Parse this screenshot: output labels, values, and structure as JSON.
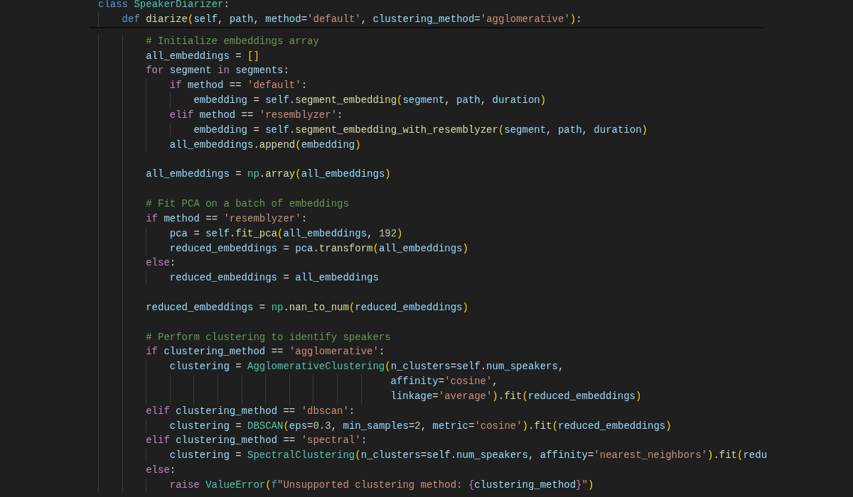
{
  "sticky_header": [
    {
      "kind": "code",
      "tokens": [
        {
          "kind": "kw",
          "text": "class "
        },
        {
          "kind": "cls",
          "text": "SpeakerDiarizer"
        },
        {
          "kind": "op",
          "text": ":"
        }
      ],
      "children": [
        {
          "kind": "code",
          "tokens": [
            {
              "kind": "kw",
              "text": "def "
            },
            {
              "kind": "fn",
              "text": "diarize"
            },
            {
              "kind": "br1",
              "text": "("
            },
            {
              "kind": "var",
              "text": "self"
            },
            {
              "kind": "op",
              "text": ", "
            },
            {
              "kind": "var",
              "text": "path"
            },
            {
              "kind": "op",
              "text": ", "
            },
            {
              "kind": "var",
              "text": "method"
            },
            {
              "kind": "op",
              "text": "="
            },
            {
              "kind": "str",
              "text": "'default'"
            },
            {
              "kind": "op",
              "text": ", "
            },
            {
              "kind": "var",
              "text": "clustering_method"
            },
            {
              "kind": "op",
              "text": "="
            },
            {
              "kind": "str",
              "text": "'agglomerative'"
            },
            {
              "kind": "br1",
              "text": ")"
            },
            {
              "kind": "op",
              "text": ":"
            }
          ]
        }
      ]
    }
  ],
  "code_lines": [
    {
      "kind": "code",
      "tokens": [
        {
          "kind": "cmt",
          "text": "# Initialize embeddings array"
        }
      ]
    },
    {
      "kind": "code",
      "tokens": [
        {
          "kind": "var",
          "text": "all_embeddings"
        },
        {
          "kind": "op",
          "text": " = "
        },
        {
          "kind": "br1",
          "text": "[]"
        }
      ]
    },
    {
      "kind": "code",
      "tokens": [
        {
          "kind": "ctrl",
          "text": "for "
        },
        {
          "kind": "var",
          "text": "segment"
        },
        {
          "kind": "ctrl",
          "text": " in "
        },
        {
          "kind": "var",
          "text": "segments"
        },
        {
          "kind": "op",
          "text": ":"
        }
      ],
      "children": [
        {
          "kind": "code",
          "tokens": [
            {
              "kind": "ctrl",
              "text": "if "
            },
            {
              "kind": "var",
              "text": "method"
            },
            {
              "kind": "op",
              "text": " == "
            },
            {
              "kind": "str",
              "text": "'default'"
            },
            {
              "kind": "op",
              "text": ":"
            }
          ],
          "children": [
            {
              "kind": "code",
              "tokens": [
                {
                  "kind": "var",
                  "text": "embedding"
                },
                {
                  "kind": "op",
                  "text": " = "
                },
                {
                  "kind": "var",
                  "text": "self"
                },
                {
                  "kind": "op",
                  "text": "."
                },
                {
                  "kind": "fn",
                  "text": "segment_embedding"
                },
                {
                  "kind": "br1",
                  "text": "("
                },
                {
                  "kind": "var",
                  "text": "segment"
                },
                {
                  "kind": "op",
                  "text": ", "
                },
                {
                  "kind": "var",
                  "text": "path"
                },
                {
                  "kind": "op",
                  "text": ", "
                },
                {
                  "kind": "var",
                  "text": "duration"
                },
                {
                  "kind": "br1",
                  "text": ")"
                }
              ]
            }
          ]
        },
        {
          "kind": "code",
          "tokens": [
            {
              "kind": "ctrl",
              "text": "elif "
            },
            {
              "kind": "var",
              "text": "method"
            },
            {
              "kind": "op",
              "text": " == "
            },
            {
              "kind": "str",
              "text": "'resemblyzer'"
            },
            {
              "kind": "op",
              "text": ":"
            }
          ],
          "children": [
            {
              "kind": "code",
              "tokens": [
                {
                  "kind": "var",
                  "text": "embedding"
                },
                {
                  "kind": "op",
                  "text": " = "
                },
                {
                  "kind": "var",
                  "text": "self"
                },
                {
                  "kind": "op",
                  "text": "."
                },
                {
                  "kind": "fn",
                  "text": "segment_embedding_with_resemblyzer"
                },
                {
                  "kind": "br1",
                  "text": "("
                },
                {
                  "kind": "var",
                  "text": "segment"
                },
                {
                  "kind": "op",
                  "text": ", "
                },
                {
                  "kind": "var",
                  "text": "path"
                },
                {
                  "kind": "op",
                  "text": ", "
                },
                {
                  "kind": "var",
                  "text": "duration"
                },
                {
                  "kind": "br1",
                  "text": ")"
                }
              ]
            }
          ]
        },
        {
          "kind": "code",
          "tokens": [
            {
              "kind": "var",
              "text": "all_embeddings"
            },
            {
              "kind": "op",
              "text": "."
            },
            {
              "kind": "fn",
              "text": "append"
            },
            {
              "kind": "br1",
              "text": "("
            },
            {
              "kind": "var",
              "text": "embedding"
            },
            {
              "kind": "br1",
              "text": ")"
            }
          ]
        }
      ]
    },
    {
      "kind": "blank"
    },
    {
      "kind": "code",
      "tokens": [
        {
          "kind": "var",
          "text": "all_embeddings"
        },
        {
          "kind": "op",
          "text": " = "
        },
        {
          "kind": "cls",
          "text": "np"
        },
        {
          "kind": "op",
          "text": "."
        },
        {
          "kind": "fn",
          "text": "array"
        },
        {
          "kind": "br1",
          "text": "("
        },
        {
          "kind": "var",
          "text": "all_embeddings"
        },
        {
          "kind": "br1",
          "text": ")"
        }
      ]
    },
    {
      "kind": "blank"
    },
    {
      "kind": "code",
      "tokens": [
        {
          "kind": "cmt",
          "text": "# Fit PCA on a batch of embeddings"
        }
      ]
    },
    {
      "kind": "code",
      "tokens": [
        {
          "kind": "ctrl",
          "text": "if "
        },
        {
          "kind": "var",
          "text": "method"
        },
        {
          "kind": "op",
          "text": " == "
        },
        {
          "kind": "str",
          "text": "'resemblyzer'"
        },
        {
          "kind": "op",
          "text": ":"
        }
      ],
      "children": [
        {
          "kind": "code",
          "tokens": [
            {
              "kind": "var",
              "text": "pca"
            },
            {
              "kind": "op",
              "text": " = "
            },
            {
              "kind": "var",
              "text": "self"
            },
            {
              "kind": "op",
              "text": "."
            },
            {
              "kind": "fn",
              "text": "fit_pca"
            },
            {
              "kind": "br1",
              "text": "("
            },
            {
              "kind": "var",
              "text": "all_embeddings"
            },
            {
              "kind": "op",
              "text": ", "
            },
            {
              "kind": "num",
              "text": "192"
            },
            {
              "kind": "br1",
              "text": ")"
            }
          ]
        },
        {
          "kind": "code",
          "tokens": [
            {
              "kind": "var",
              "text": "reduced_embeddings"
            },
            {
              "kind": "op",
              "text": " = "
            },
            {
              "kind": "var",
              "text": "pca"
            },
            {
              "kind": "op",
              "text": "."
            },
            {
              "kind": "fn",
              "text": "transform"
            },
            {
              "kind": "br1",
              "text": "("
            },
            {
              "kind": "var",
              "text": "all_embeddings"
            },
            {
              "kind": "br1",
              "text": ")"
            }
          ]
        }
      ]
    },
    {
      "kind": "code",
      "tokens": [
        {
          "kind": "ctrl",
          "text": "else"
        },
        {
          "kind": "op",
          "text": ":"
        }
      ],
      "children": [
        {
          "kind": "code",
          "tokens": [
            {
              "kind": "var",
              "text": "reduced_embeddings"
            },
            {
              "kind": "op",
              "text": " = "
            },
            {
              "kind": "var",
              "text": "all_embeddings"
            }
          ]
        }
      ]
    },
    {
      "kind": "blank"
    },
    {
      "kind": "code",
      "tokens": [
        {
          "kind": "var",
          "text": "reduced_embeddings"
        },
        {
          "kind": "op",
          "text": " = "
        },
        {
          "kind": "cls",
          "text": "np"
        },
        {
          "kind": "op",
          "text": "."
        },
        {
          "kind": "fn",
          "text": "nan_to_num"
        },
        {
          "kind": "br1",
          "text": "("
        },
        {
          "kind": "var",
          "text": "reduced_embeddings"
        },
        {
          "kind": "br1",
          "text": ")"
        }
      ]
    },
    {
      "kind": "blank"
    },
    {
      "kind": "code",
      "tokens": [
        {
          "kind": "cmt",
          "text": "# Perform clustering to identify speakers"
        }
      ]
    },
    {
      "kind": "code",
      "tokens": [
        {
          "kind": "ctrl",
          "text": "if "
        },
        {
          "kind": "var",
          "text": "clustering_method"
        },
        {
          "kind": "op",
          "text": " == "
        },
        {
          "kind": "str",
          "text": "'agglomerative'"
        },
        {
          "kind": "op",
          "text": ":"
        }
      ],
      "children": [
        {
          "kind": "code",
          "tokens": [
            {
              "kind": "var",
              "text": "clustering"
            },
            {
              "kind": "op",
              "text": " = "
            },
            {
              "kind": "cls",
              "text": "AgglomerativeClustering"
            },
            {
              "kind": "br1",
              "text": "("
            },
            {
              "kind": "var",
              "text": "n_clusters"
            },
            {
              "kind": "op",
              "text": "="
            },
            {
              "kind": "var",
              "text": "self"
            },
            {
              "kind": "op",
              "text": "."
            },
            {
              "kind": "var",
              "text": "num_speakers"
            },
            {
              "kind": "op",
              "text": ","
            }
          ],
          "children": [
            {
              "kind": "continuation",
              "tokens": [
                {
                  "kind": "var",
                  "text": "affinity"
                },
                {
                  "kind": "op",
                  "text": "="
                },
                {
                  "kind": "str",
                  "text": "'cosine'"
                },
                {
                  "kind": "op",
                  "text": ","
                }
              ]
            },
            {
              "kind": "continuation",
              "tokens": [
                {
                  "kind": "var",
                  "text": "linkage"
                },
                {
                  "kind": "op",
                  "text": "="
                },
                {
                  "kind": "str",
                  "text": "'average'"
                },
                {
                  "kind": "br1",
                  "text": ")"
                },
                {
                  "kind": "op",
                  "text": "."
                },
                {
                  "kind": "fn",
                  "text": "fit"
                },
                {
                  "kind": "br1",
                  "text": "("
                },
                {
                  "kind": "var",
                  "text": "reduced_embeddings"
                },
                {
                  "kind": "br1",
                  "text": ")"
                }
              ]
            }
          ]
        }
      ]
    },
    {
      "kind": "code",
      "tokens": [
        {
          "kind": "ctrl",
          "text": "elif "
        },
        {
          "kind": "var",
          "text": "clustering_method"
        },
        {
          "kind": "op",
          "text": " == "
        },
        {
          "kind": "str",
          "text": "'dbscan'"
        },
        {
          "kind": "op",
          "text": ":"
        }
      ],
      "children": [
        {
          "kind": "code",
          "tokens": [
            {
              "kind": "var",
              "text": "clustering"
            },
            {
              "kind": "op",
              "text": " = "
            },
            {
              "kind": "cls",
              "text": "DBSCAN"
            },
            {
              "kind": "br1",
              "text": "("
            },
            {
              "kind": "var",
              "text": "eps"
            },
            {
              "kind": "op",
              "text": "="
            },
            {
              "kind": "num",
              "text": "0.3"
            },
            {
              "kind": "op",
              "text": ", "
            },
            {
              "kind": "var",
              "text": "min_samples"
            },
            {
              "kind": "op",
              "text": "="
            },
            {
              "kind": "num",
              "text": "2"
            },
            {
              "kind": "op",
              "text": ", "
            },
            {
              "kind": "var",
              "text": "metric"
            },
            {
              "kind": "op",
              "text": "="
            },
            {
              "kind": "str",
              "text": "'cosine'"
            },
            {
              "kind": "br1",
              "text": ")"
            },
            {
              "kind": "op",
              "text": "."
            },
            {
              "kind": "fn",
              "text": "fit"
            },
            {
              "kind": "br1",
              "text": "("
            },
            {
              "kind": "var",
              "text": "reduced_embeddings"
            },
            {
              "kind": "br1",
              "text": ")"
            }
          ]
        }
      ]
    },
    {
      "kind": "code",
      "tokens": [
        {
          "kind": "ctrl",
          "text": "elif "
        },
        {
          "kind": "var",
          "text": "clustering_method"
        },
        {
          "kind": "op",
          "text": " == "
        },
        {
          "kind": "str",
          "text": "'spectral'"
        },
        {
          "kind": "op",
          "text": ":"
        }
      ],
      "children": [
        {
          "kind": "code",
          "tokens": [
            {
              "kind": "var",
              "text": "clustering"
            },
            {
              "kind": "op",
              "text": " = "
            },
            {
              "kind": "cls",
              "text": "SpectralClustering"
            },
            {
              "kind": "br1",
              "text": "("
            },
            {
              "kind": "var",
              "text": "n_clusters"
            },
            {
              "kind": "op",
              "text": "="
            },
            {
              "kind": "var",
              "text": "self"
            },
            {
              "kind": "op",
              "text": "."
            },
            {
              "kind": "var",
              "text": "num_speakers"
            },
            {
              "kind": "op",
              "text": ", "
            },
            {
              "kind": "var",
              "text": "affinity"
            },
            {
              "kind": "op",
              "text": "="
            },
            {
              "kind": "str",
              "text": "'nearest_neighbors'"
            },
            {
              "kind": "br1",
              "text": ")"
            },
            {
              "kind": "op",
              "text": "."
            },
            {
              "kind": "fn",
              "text": "fit"
            },
            {
              "kind": "br1",
              "text": "("
            },
            {
              "kind": "var",
              "text": "redu"
            }
          ]
        }
      ]
    },
    {
      "kind": "code",
      "tokens": [
        {
          "kind": "ctrl",
          "text": "else"
        },
        {
          "kind": "op",
          "text": ":"
        }
      ],
      "children": [
        {
          "kind": "code",
          "tokens": [
            {
              "kind": "ctrl",
              "text": "raise "
            },
            {
              "kind": "cls",
              "text": "ValueError"
            },
            {
              "kind": "br1",
              "text": "("
            },
            {
              "kind": "kw",
              "text": "f"
            },
            {
              "kind": "str",
              "text": "\"Unsupported clustering method: "
            },
            {
              "kind": "br2",
              "text": "{"
            },
            {
              "kind": "var",
              "text": "clustering_method"
            },
            {
              "kind": "br2",
              "text": "}"
            },
            {
              "kind": "str",
              "text": "\""
            },
            {
              "kind": "br1",
              "text": ")"
            }
          ]
        }
      ]
    }
  ]
}
